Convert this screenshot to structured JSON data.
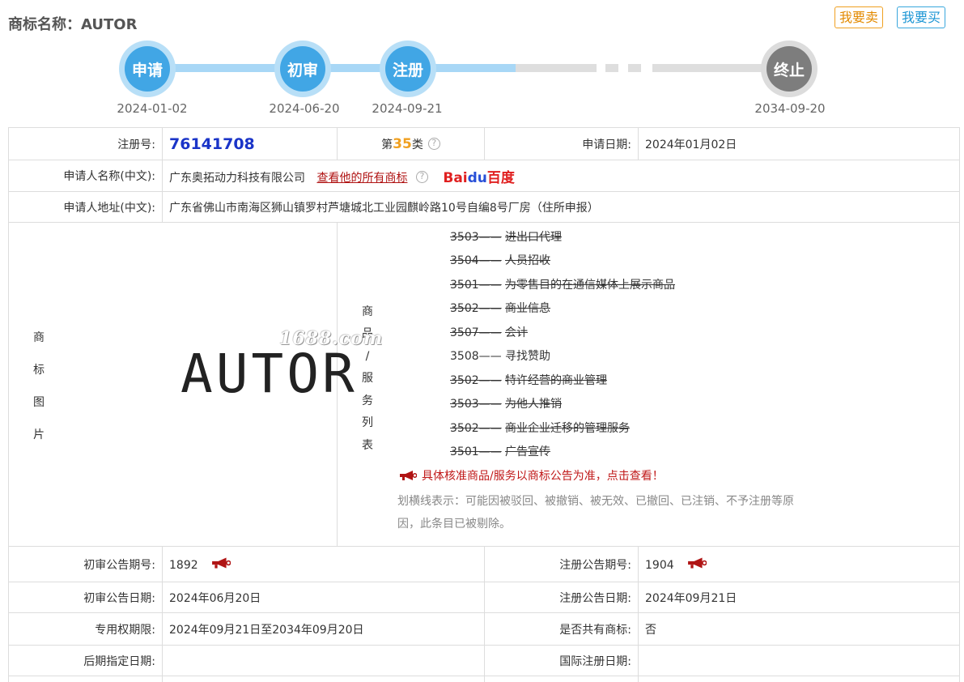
{
  "page": {
    "title": "商标名称：AUTOR",
    "sell_label": "我要卖",
    "buy_label": "我要买"
  },
  "timeline": [
    {
      "label": "申请",
      "date": "2024-01-02"
    },
    {
      "label": "初审",
      "date": "2024-06-20"
    },
    {
      "label": "注册",
      "date": "2024-09-21"
    },
    {
      "label": "终止",
      "date": "2034-09-20"
    }
  ],
  "info": {
    "reg_no_label": "注册号:",
    "reg_no": "76141708",
    "class_prefix": "第",
    "class_num": "35",
    "class_suffix": "类",
    "apply_date_label": "申请日期:",
    "apply_date": "2024年01月02日",
    "applicant_label": "申请人名称(中文):",
    "applicant": "广东奥拓动力科技有限公司",
    "all_marks_link": "查看他的所有商标",
    "baidu_b1": "Bai",
    "baidu_b2": "du",
    "baidu_b3": "百度",
    "address_label": "申请人地址(中文):",
    "address": "广东省佛山市南海区狮山镇罗村芦塘城北工业园麒岭路10号自编8号厂房（住所申报）",
    "mark_image_label": [
      "商",
      "标",
      "图",
      "片"
    ],
    "mark_word": "AUTOR",
    "services_label": [
      "商",
      "品",
      "/",
      "服",
      "务",
      "列",
      "表"
    ],
    "watermark": "1688.com",
    "services": [
      {
        "code": "3503——",
        "name": "进出口代理",
        "struck": true
      },
      {
        "code": "3504——",
        "name": "人员招收",
        "struck": true
      },
      {
        "code": "3501——",
        "name": "为零售目的在通信媒体上展示商品",
        "struck": true
      },
      {
        "code": "3502——",
        "name": "商业信息",
        "struck": true
      },
      {
        "code": "3507——",
        "name": "会计",
        "struck": true
      },
      {
        "code": "3508——",
        "name": "寻找赞助",
        "struck": false
      },
      {
        "code": "3502——",
        "name": "特许经营的商业管理",
        "struck": true
      },
      {
        "code": "3503——",
        "name": "为他人推销",
        "struck": true
      },
      {
        "code": "3502——",
        "name": "商业企业迁移的管理服务",
        "struck": true
      },
      {
        "code": "3501——",
        "name": "广告宣传",
        "struck": true
      }
    ],
    "notice": "具体核准商品/服务以商标公告为准，点击查看！",
    "strike_note": "划横线表示：可能因被驳回、被撤销、被无效、已撤回、已注销、不予注册等原因，此条目已被剔除。",
    "prelim_issue_label": "初审公告期号:",
    "prelim_issue": "1892",
    "reg_issue_label": "注册公告期号:",
    "reg_issue": "1904",
    "prelim_date_label": "初审公告日期:",
    "prelim_date": "2024年06月20日",
    "reg_date_label": "注册公告日期:",
    "reg_date": "2024年09月21日",
    "exclusive_label": "专用权期限:",
    "exclusive": "2024年09月21日至2034年09月20日",
    "shared_label": "是否共有商标:",
    "shared": "否",
    "later_date_label": "后期指定日期:",
    "later_date": "",
    "intl_date_label": "国际注册日期:",
    "intl_date": ""
  },
  "colors": {
    "timeline_active": "#41a6e5",
    "timeline_inactive": "#7d7d7d",
    "reg_no": "#1a34c8",
    "class_num": "#f0a020",
    "notice": "#c01818"
  }
}
